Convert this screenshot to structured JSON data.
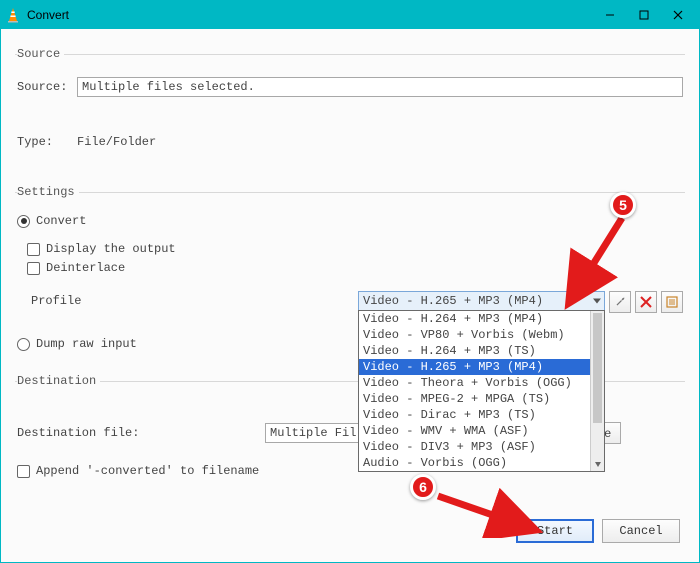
{
  "window": {
    "title": "Convert",
    "buttons": {
      "minimize": "—",
      "maximize": "▢",
      "close": "✕"
    }
  },
  "source": {
    "legend": "Source",
    "label": "Source:",
    "value": "Multiple files selected.",
    "type_label": "Type:",
    "type_value": "File/Folder"
  },
  "settings": {
    "legend": "Settings",
    "convert_label": "Convert",
    "display_label": "Display the output",
    "deinterlace_label": "Deinterlace",
    "profile_label": "Profile",
    "profile_selected": "Video - H.265 + MP3 (MP4)",
    "profile_options": [
      "Video - H.264 + MP3 (MP4)",
      "Video - VP80 + Vorbis (Webm)",
      "Video - H.264 + MP3 (TS)",
      "Video - H.265 + MP3 (MP4)",
      "Video - Theora + Vorbis (OGG)",
      "Video - MPEG-2 + MPGA (TS)",
      "Video - Dirac + MP3 (TS)",
      "Video - WMV + WMA (ASF)",
      "Video - DIV3 + MP3 (ASF)",
      "Audio - Vorbis (OGG)"
    ],
    "profile_selected_index": 3,
    "dump_label": "Dump raw input"
  },
  "destination": {
    "legend": "Destination",
    "file_label": "Destination file:",
    "file_value": "Multiple Fil",
    "browse_label": "Browse",
    "append_label": "Append '-converted' to filename"
  },
  "actions": {
    "start": "Start",
    "cancel": "Cancel"
  },
  "annotations": {
    "badge5": "5",
    "badge6": "6"
  },
  "icons": {
    "wrench": "wrench-icon",
    "delete": "delete-icon",
    "new_profile": "new-profile-icon"
  }
}
